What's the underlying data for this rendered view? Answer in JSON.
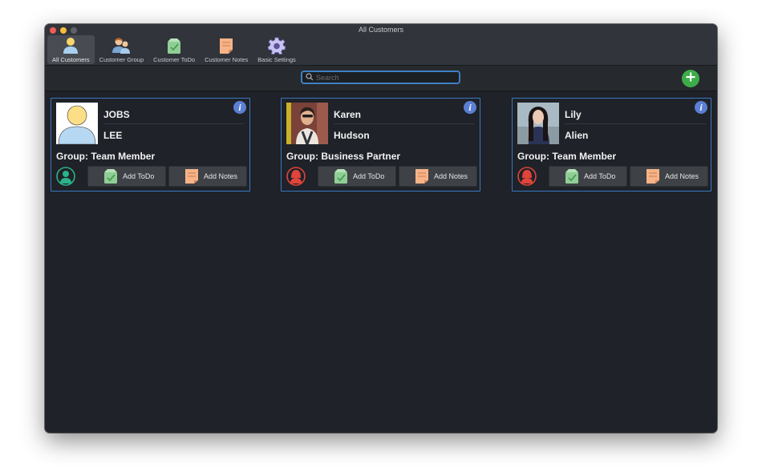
{
  "window": {
    "title": "All Customers"
  },
  "toolbar": {
    "items": [
      {
        "label": "All Customers",
        "icon": "person-icon",
        "active": true
      },
      {
        "label": "Customer Group",
        "icon": "group-icon",
        "active": false
      },
      {
        "label": "Customer ToDo",
        "icon": "todo-bag-icon",
        "active": false
      },
      {
        "label": "Customer Notes",
        "icon": "note-icon",
        "active": false
      },
      {
        "label": "Basic Settings",
        "icon": "gear-icon",
        "active": false
      }
    ]
  },
  "search": {
    "placeholder": "Search",
    "value": ""
  },
  "add_button": {
    "icon": "plus-icon",
    "color": "#3dac4a"
  },
  "customers": [
    {
      "first_name": "JOBS",
      "last_name": "LEE",
      "group": "Group: Team Member",
      "avatar_color": "#2bb38a",
      "todo_label": "Add ToDo",
      "notes_label": "Add Notes"
    },
    {
      "first_name": "Karen",
      "last_name": "Hudson",
      "group": "Group: Business Partner",
      "avatar_color": "#e0443a",
      "todo_label": "Add ToDo",
      "notes_label": "Add Notes"
    },
    {
      "first_name": "Lily",
      "last_name": "Alien",
      "group": "Group: Team Member",
      "avatar_color": "#e0443a",
      "todo_label": "Add ToDo",
      "notes_label": "Add Notes"
    }
  ],
  "colors": {
    "accent": "#3a78c2",
    "info": "#5a7fd3",
    "background": "#1f2228"
  }
}
